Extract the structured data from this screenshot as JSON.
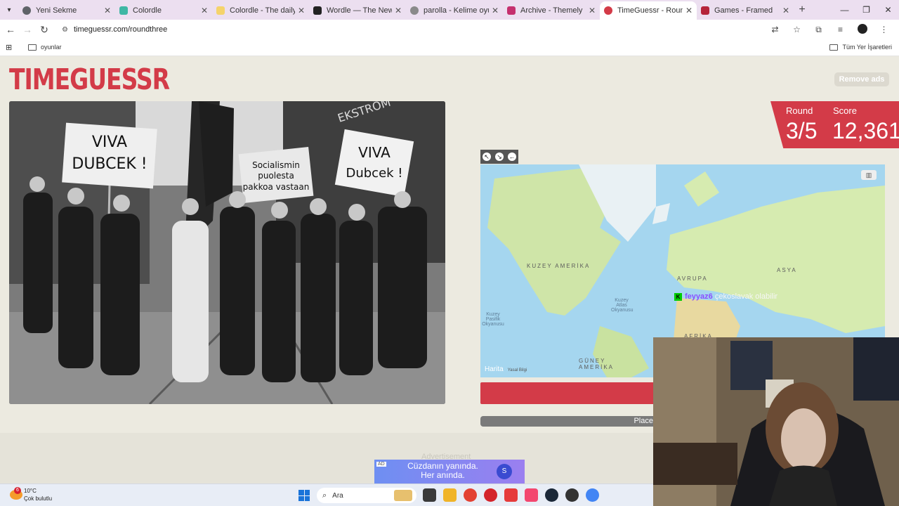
{
  "browser": {
    "tabs": [
      {
        "label": "Yeni Sekme",
        "color": "#5f6368",
        "active": false
      },
      {
        "label": "Colordle",
        "color": "#3fb7a4",
        "active": false
      },
      {
        "label": "Colordle - The daily color",
        "color": "#f5d36b",
        "active": false
      },
      {
        "label": "Wordle — The New York Time",
        "color": "#222222",
        "active": false
      },
      {
        "label": "parolla - Kelime oyunu. G",
        "color": "#8a8a8a",
        "active": false
      },
      {
        "label": "Archive - Themely",
        "color": "#c5306e",
        "active": false
      },
      {
        "label": "TimeGuessr - Round Three",
        "color": "#d33b48",
        "active": true
      },
      {
        "label": "Games - Framed",
        "color": "#b5243a",
        "active": false
      }
    ],
    "url": "timeguessr.com/roundthree",
    "bookmarks": {
      "folder": "oyunlar",
      "all_bookmarks": "Tüm Yer İşaretleri"
    }
  },
  "page": {
    "logo": "TIMEGUESSR",
    "remove_ads": "Remove ads",
    "round_label": "Round",
    "round_value": "3/5",
    "score_label": "Score",
    "score_value": "12,361",
    "photo_signs": [
      "VIVA DUBCEK !",
      "Socialismin puolesta pakkoa vastaan",
      "VIVA Dubcek !"
    ],
    "photo_storefront": "EKSTRÖM",
    "map": {
      "labels": {
        "north_america": "KUZEY AMERİKA",
        "europe": "AVRUPA",
        "asia": "ASYA",
        "south_america": "GÜNEY AMERİKA",
        "africa": "AFRİKA",
        "atlantic": "Kuzey Atlas Okyanusu",
        "pacific": "Kuzey Pasifik Okyanusu"
      },
      "credit": "Harita",
      "legal": "Yasal Bilgi"
    },
    "chat": {
      "badge": "K",
      "user": "feyyaz6",
      "message": "çekoslavak olabilir"
    },
    "place_button": "Place",
    "advertisement_label": "Advertisement",
    "ad": {
      "badge": "AD",
      "line1": "Cüzdanın yanında.",
      "line2": "Her anında."
    }
  },
  "taskbar": {
    "temperature": "10°C",
    "condition": "Çok bulutlu",
    "weather_badge": "6",
    "search_placeholder": "Ara"
  }
}
